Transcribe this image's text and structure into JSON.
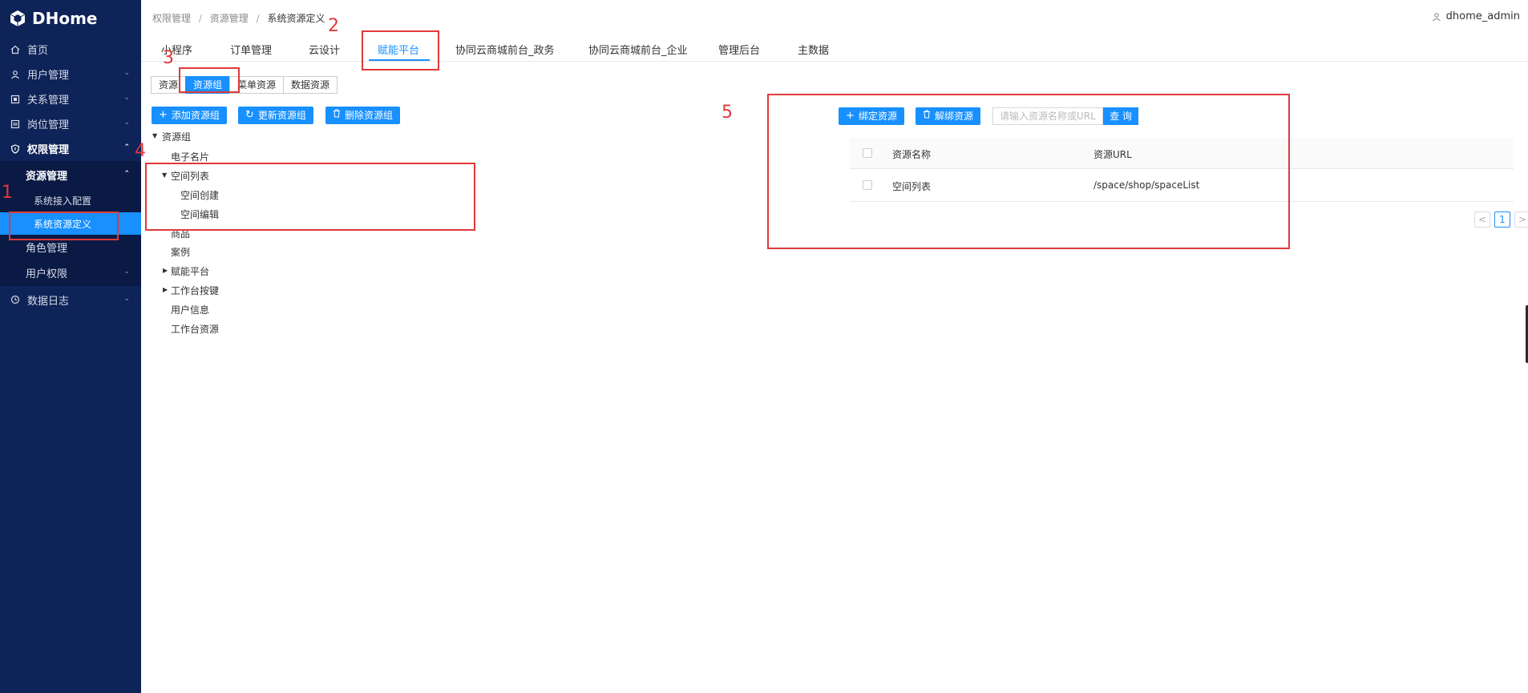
{
  "app": {
    "logo_text": "DHome"
  },
  "sidebar": {
    "items": [
      {
        "label": "首页",
        "icon": "home-icon"
      },
      {
        "label": "用户管理",
        "icon": "user-icon"
      },
      {
        "label": "关系管理",
        "icon": "relation-icon"
      },
      {
        "label": "岗位管理",
        "icon": "post-icon"
      },
      {
        "label": "权限管理",
        "icon": "shield-icon"
      },
      {
        "label": "资源管理"
      },
      {
        "label": "系统接入配置"
      },
      {
        "label": "系统资源定义"
      },
      {
        "label": "角色管理"
      },
      {
        "label": "用户权限"
      },
      {
        "label": "数据日志",
        "icon": "log-icon"
      }
    ]
  },
  "breadcrumb": {
    "items": [
      "权限管理",
      "资源管理",
      "系统资源定义"
    ]
  },
  "user": {
    "name": "dhome_admin"
  },
  "tabs": [
    "小程序",
    "订单管理",
    "云设计",
    "赋能平台",
    "协同云商城前台_政务",
    "协同云商城前台_企业",
    "管理后台",
    "主数据"
  ],
  "segments": [
    "资源",
    "资源组",
    "菜单资源",
    "数据资源"
  ],
  "actions": {
    "add_group": "添加资源组",
    "update_group": "更新资源组",
    "delete_group": "删除资源组",
    "bind": "绑定资源",
    "unbind": "解绑资源",
    "search_placeholder": "请输入资源名称或URL",
    "query": "查 询"
  },
  "tree": {
    "root": "资源组",
    "nodes": [
      "电子名片",
      "空间列表",
      "空间创建",
      "空间编辑",
      "商品",
      "案例",
      "赋能平台",
      "工作台按键",
      "用户信息",
      "工作台资源"
    ]
  },
  "table": {
    "headers": [
      "资源名称",
      "资源URL"
    ],
    "rows": [
      {
        "name": "空间列表",
        "url": "/space/shop/spaceList"
      }
    ]
  },
  "pagination": {
    "current": "1",
    "prev": "<",
    "next": ">"
  },
  "annotations": [
    "1",
    "2",
    "3",
    "4",
    "5"
  ],
  "colors": {
    "sidebar": "#0e2357",
    "accent": "#1890ff",
    "annotation": "#e03a3a"
  }
}
